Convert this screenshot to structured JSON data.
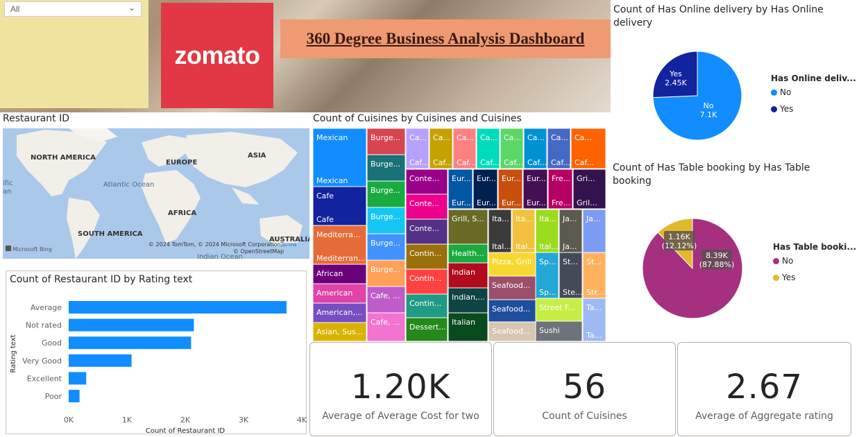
{
  "slicer": {
    "value": "All"
  },
  "header": {
    "logo_text": "zomato",
    "title": "360 Degree Business Analysis Dashboard"
  },
  "map": {
    "title": "Restaurant ID",
    "continents": [
      "NORTH AMERICA",
      "EUROPE",
      "ASIA",
      "AFRICA",
      "SOUTH AMERICA",
      "AUSTRALIA"
    ],
    "oceans": [
      "Atlantic Ocean",
      "Indian Ocean"
    ],
    "edge_text": [
      "ific",
      "an"
    ],
    "attribution": "© 2024 TomTom, © 2024 Microsoft Corporation,",
    "terms": "Terms",
    "osm": "© OpenStreetMap",
    "bing": "Microsoft Bing"
  },
  "treemap": {
    "title": "Count of Cuisines by Cuisines and Cuisines",
    "cells": [
      {
        "t": "Mexican",
        "b": "Mexican",
        "c": "#118dff"
      },
      {
        "t": "Cafe",
        "b": "Cafe",
        "c": "#12239e"
      },
      {
        "t": "Mediterra...",
        "b": "Mediterran...",
        "c": "#e66c37"
      },
      {
        "t": "African",
        "b": "",
        "c": "#6b007b"
      },
      {
        "t": "American",
        "b": "",
        "c": "#e044a7"
      },
      {
        "t": "American,...",
        "b": "",
        "c": "#744ec2"
      },
      {
        "t": "Asian, Sus...",
        "b": "",
        "c": "#d9b300"
      },
      {
        "t": "Burge...",
        "b": "",
        "c": "#d64550"
      },
      {
        "t": "Burge...",
        "b": "",
        "c": "#197278"
      },
      {
        "t": "Burge...",
        "b": "",
        "c": "#1aab40"
      },
      {
        "t": "Burge...",
        "b": "",
        "c": "#15c6f4"
      },
      {
        "t": "Burge...",
        "b": "",
        "c": "#4092ff"
      },
      {
        "t": "Burge...",
        "b": "",
        "c": "#ffa058"
      },
      {
        "t": "Cafe, ...",
        "b": "",
        "c": "#be5dc9"
      },
      {
        "t": "Cafe, ...",
        "b": "",
        "c": "#f472d0"
      },
      {
        "t": "Ca...",
        "b": "Caf...",
        "c": "#b5a1ff"
      },
      {
        "t": "Ca...",
        "b": "Caf...",
        "c": "#c4a200"
      },
      {
        "t": "Ca...",
        "b": "Caf...",
        "c": "#ff8080"
      },
      {
        "t": "Ca...",
        "b": "Caf...",
        "c": "#00dbbc"
      },
      {
        "t": "Ca...",
        "b": "Caf...",
        "c": "#5bd667"
      },
      {
        "t": "Ca...",
        "b": "Caf...",
        "c": "#0091d5"
      },
      {
        "t": "Ca...",
        "b": "Caf...",
        "c": "#4668c5"
      },
      {
        "t": "Ca...",
        "b": "Caf...",
        "c": "#ff6300"
      },
      {
        "t": "Conte...",
        "b": "",
        "c": "#99008a"
      },
      {
        "t": "Conte...",
        "b": "",
        "c": "#ec008c"
      },
      {
        "t": "Conte...",
        "b": "",
        "c": "#533285"
      },
      {
        "t": "Contin...",
        "b": "",
        "c": "#99700a"
      },
      {
        "t": "Contin...",
        "b": "",
        "c": "#ff4141"
      },
      {
        "t": "Contin...",
        "b": "",
        "c": "#1f9a85"
      },
      {
        "t": "Dessert...",
        "b": "",
        "c": "#25891c"
      },
      {
        "t": "Eur...",
        "b": "Eur...",
        "c": "#0057a2"
      },
      {
        "t": "Eur...",
        "b": "Eur...",
        "c": "#002050"
      },
      {
        "t": "Eur...",
        "b": "Eur...",
        "c": "#c94f0f"
      },
      {
        "t": "Eur...",
        "b": "Eur...",
        "c": "#450f54"
      },
      {
        "t": "Fre...",
        "b": "Fre...",
        "c": "#b60064"
      },
      {
        "t": "Gri...",
        "b": "Gril...",
        "c": "#34124f"
      },
      {
        "t": "Grill, S...",
        "b": "",
        "c": "#6a6a27"
      },
      {
        "t": "Health...",
        "b": "",
        "c": "#1aab40"
      },
      {
        "t": "Indian",
        "b": "",
        "c": "#b20b1e"
      },
      {
        "t": "Indian,...",
        "b": "",
        "c": "#0e4441"
      },
      {
        "t": "Italian",
        "b": "",
        "c": "#0a4a1f"
      },
      {
        "t": "Ita...",
        "b": "Ital...",
        "c": "#3b3b3b"
      },
      {
        "t": "Ita...",
        "b": "Ital...",
        "c": "#f2c23e"
      },
      {
        "t": "Ita...",
        "b": "Ital...",
        "c": "#9cdc1e"
      },
      {
        "t": "Ja...",
        "b": "Ja...",
        "c": "#5c5a4f"
      },
      {
        "t": "Ja...",
        "b": "",
        "c": "#7c9cf3"
      },
      {
        "t": "Pizza, Grill",
        "b": "",
        "c": "#f7d82f"
      },
      {
        "t": "Seafood...",
        "b": "",
        "c": "#9c4f6b"
      },
      {
        "t": "Seafood...",
        "b": "",
        "c": "#1e4f9c"
      },
      {
        "t": "Seafood...",
        "b": "",
        "c": "#d8c6b0"
      },
      {
        "t": "Sp...",
        "b": "Sp...",
        "c": "#22a7d6"
      },
      {
        "t": "St...",
        "b": "Ste...",
        "c": "#444a58"
      },
      {
        "t": "St...",
        "b": "Str...",
        "c": "#ffb15c"
      },
      {
        "t": "Street F...",
        "b": "",
        "c": "#c5ef44"
      },
      {
        "t": "Sushi",
        "b": "",
        "c": "#6e7279"
      },
      {
        "t": "Ta...",
        "b": "Ta...",
        "c": "#9fb9f5"
      }
    ]
  },
  "bar_chart": {
    "title": "Count of Restaurant ID by Rating text",
    "xlabel": "Count of Restaurant ID",
    "ylabel": "Rating text",
    "bar_color": "#118dff"
  },
  "chart_data": [
    {
      "type": "bar",
      "orientation": "horizontal",
      "title": "Count of Restaurant ID by Rating text",
      "categories": [
        "Average",
        "Not rated",
        "Good",
        "Very Good",
        "Excellent",
        "Poor"
      ],
      "values": [
        3737,
        2148,
        2100,
        1079,
        301,
        186
      ],
      "xlabel": "Count of Restaurant ID",
      "ylabel": "Rating text",
      "xlim": [
        0,
        4000
      ],
      "xticks": [
        "0K",
        "1K",
        "2K",
        "3K",
        "4K"
      ]
    },
    {
      "type": "pie",
      "title": "Count of Has Online delivery by Has Online delivery",
      "legend_title": "Has Online deliv...",
      "legend_position": "right",
      "slices": [
        {
          "name": "No",
          "value": 7100,
          "label": "No\n7.1K",
          "color": "#118dff"
        },
        {
          "name": "Yes",
          "value": 2450,
          "label": "Yes\n2.45K",
          "color": "#12239e"
        }
      ]
    },
    {
      "type": "pie",
      "title": "Count of Has Table booking by Has Table booking",
      "legend_title": "Has Table booki...",
      "legend_position": "right",
      "slices": [
        {
          "name": "No",
          "value": 8390,
          "label": "8.39K\n(87.88%)",
          "color": "#a5307f"
        },
        {
          "name": "Yes",
          "value": 1160,
          "label": "1.16K\n(12.12%)",
          "color": "#e0b92c"
        }
      ]
    }
  ],
  "kpis": [
    {
      "value": "1.20K",
      "label": "Average of Average Cost for two"
    },
    {
      "value": "56",
      "label": "Count of Cuisines"
    },
    {
      "value": "2.67",
      "label": "Average of Aggregate rating"
    }
  ]
}
